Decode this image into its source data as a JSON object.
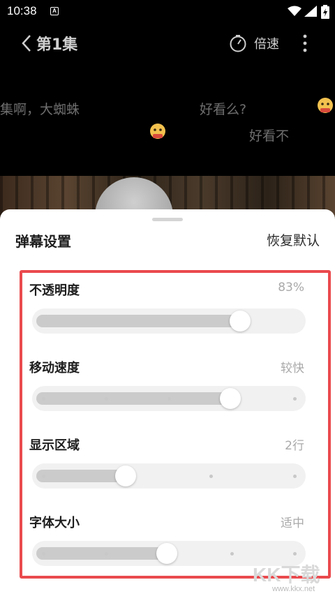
{
  "status_bar": {
    "time": "10:38",
    "notification_badge": "A"
  },
  "header": {
    "back_label": "第1集",
    "speed_label": "倍速"
  },
  "danmaku": [
    {
      "text": "集啊，大蜘蛛"
    },
    {
      "text": "好看么?"
    },
    {
      "text": "好看不"
    }
  ],
  "sheet": {
    "title": "弹幕设置",
    "reset_label": "恢复默认",
    "settings": [
      {
        "label": "不透明度",
        "value": "83%",
        "level": 0.83
      },
      {
        "label": "移动速度",
        "value": "较快",
        "level": 0.75
      },
      {
        "label": "显示区域",
        "value": "2行",
        "level": 0.33
      },
      {
        "label": "字体大小",
        "value": "适中",
        "level": 0.5
      }
    ]
  },
  "watermark": {
    "text": "KK下载",
    "url": "www.kkx.net"
  },
  "colors": {
    "highlight": "#ea4a4e",
    "sheet_bg": "#ffffff",
    "track": "#f1f1f1",
    "fill": "#cbcbcb"
  }
}
